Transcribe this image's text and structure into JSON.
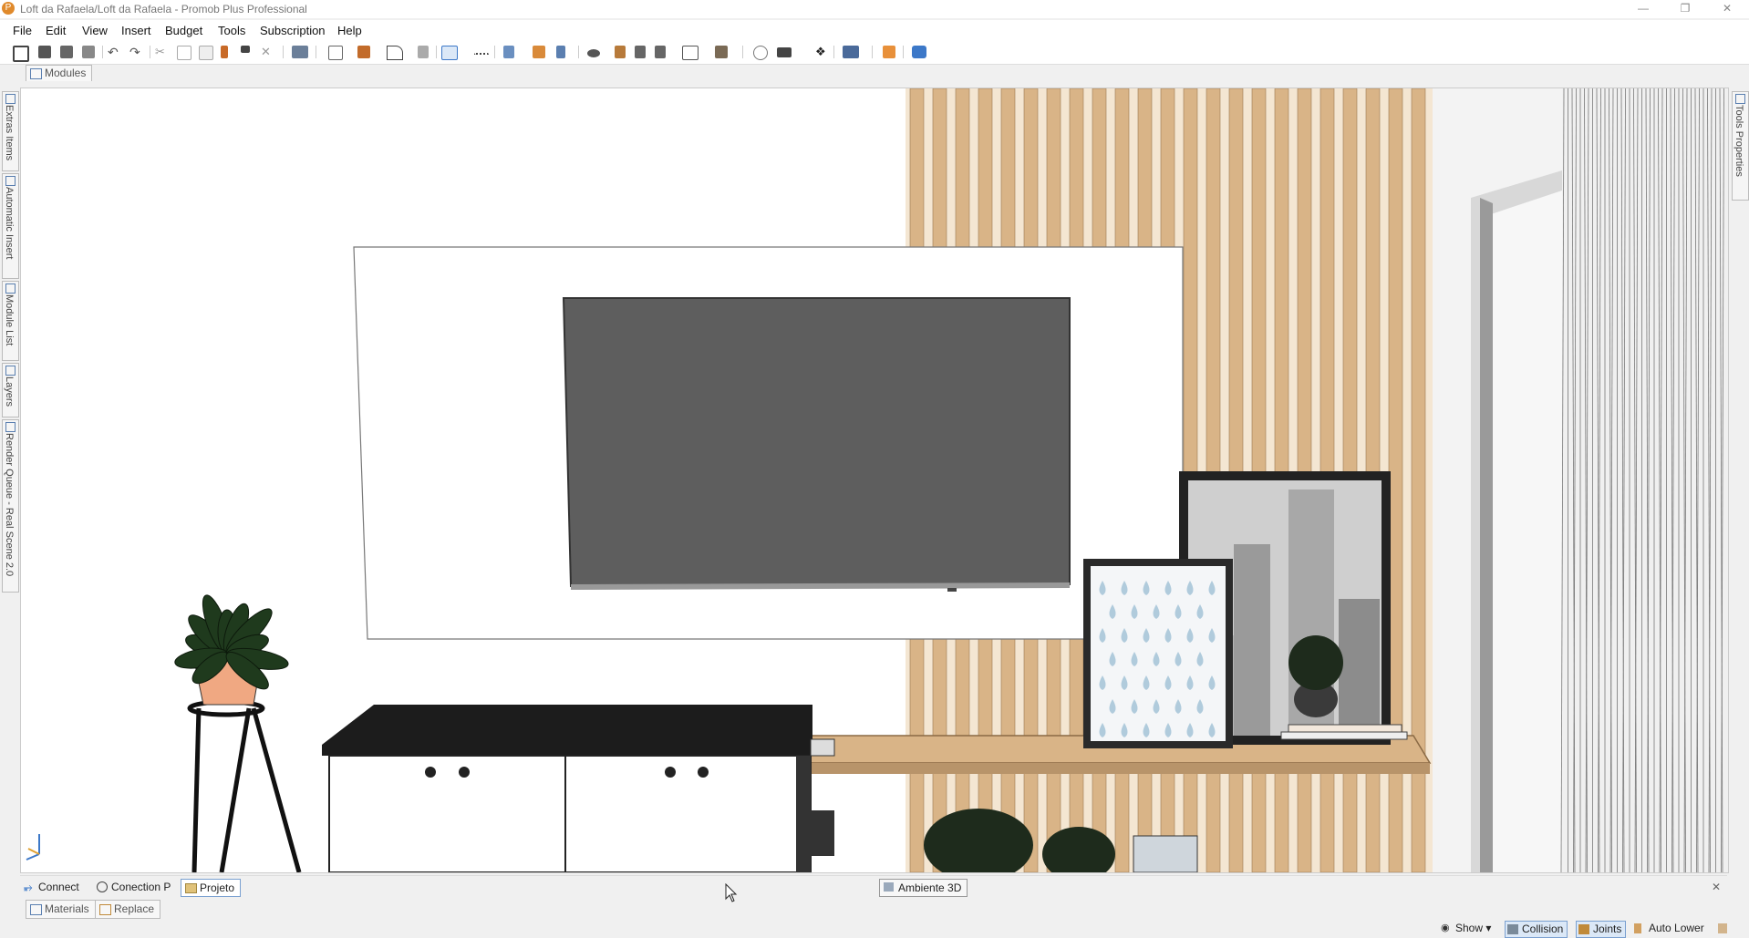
{
  "window": {
    "title": "Loft da Rafaela/Loft da Rafaela - Promob Plus Professional",
    "app_icon": "promob-icon",
    "controls": [
      "minimize-icon",
      "restore-icon",
      "close-icon"
    ]
  },
  "menu": {
    "items": [
      "File",
      "Edit",
      "View",
      "Insert",
      "Budget",
      "Tools",
      "Subscription",
      "Help"
    ]
  },
  "toolbar": {
    "icons": [
      "save-icon",
      "open-icon",
      "print-icon",
      "print-preview-icon",
      "undo-icon",
      "redo-icon",
      "cut-icon",
      "copy-icon",
      "paste-icon",
      "hammer-icon",
      "paint-icon",
      "delete-icon",
      "render-icon",
      "insert-icon",
      "group-icon",
      "draw-icon",
      "table-icon",
      "select-icon",
      "measure-icon",
      "material-icon",
      "edit-icon",
      "mirror-icon",
      "eye-icon",
      "rotate-icon",
      "prev-view-icon",
      "next-view-icon",
      "views-icon",
      "cube-icon",
      "tools-icon",
      "camera-icon",
      "pan-icon",
      "align-icon",
      "user-icon",
      "chat-icon"
    ]
  },
  "top_tab": {
    "label": "Modules"
  },
  "left_panels": [
    "Extras Items",
    "Automatic Insert",
    "Module List",
    "Layers",
    "Render Queue - Real Scene 2.0"
  ],
  "right_panels": [
    "Tools Properties"
  ],
  "document_tabs": [
    {
      "label": "Connect",
      "active": false,
      "icon": "connect-icon"
    },
    {
      "label": "Conection P",
      "active": false,
      "icon": "plug-icon"
    },
    {
      "label": "Projeto",
      "active": true,
      "icon": "folder-icon"
    },
    {
      "label": "Ambiente 3D",
      "active": false,
      "icon": "ambiente-icon"
    }
  ],
  "bottom_tabs": [
    {
      "label": "Materials",
      "icon": "materials-icon"
    },
    {
      "label": "Replace",
      "icon": "replace-icon"
    }
  ],
  "status": {
    "show_label": "Show",
    "collision_label": "Collision",
    "joints_label": "Joints",
    "auto_lower_label": "Auto Lower"
  },
  "colors": {
    "accent": "#3c78c8",
    "wood": "#d9b487",
    "wall": "#ffffff",
    "tv": "#5e5e5e",
    "cabinet_top": "#1c1c1c",
    "plant": "#1f3a1d",
    "pot": "#f0a882"
  }
}
